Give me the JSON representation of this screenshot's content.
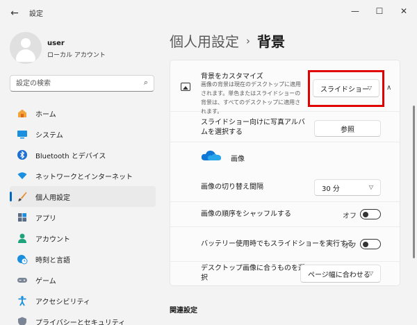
{
  "window": {
    "title": "設定",
    "back_icon": "←",
    "min_icon": "—",
    "max_icon": "☐",
    "close_icon": "✕"
  },
  "profile": {
    "name": "user",
    "account_type": "ローカル アカウント"
  },
  "search": {
    "placeholder": "設定の検索",
    "icon": "⌕"
  },
  "sidebar": {
    "items": [
      {
        "label": "ホーム",
        "icon": "home-icon"
      },
      {
        "label": "システム",
        "icon": "system-icon"
      },
      {
        "label": "Bluetooth とデバイス",
        "icon": "bluetooth-icon"
      },
      {
        "label": "ネットワークとインターネット",
        "icon": "wifi-icon"
      },
      {
        "label": "個人用設定",
        "icon": "brush-icon",
        "active": true
      },
      {
        "label": "アプリ",
        "icon": "apps-icon"
      },
      {
        "label": "アカウント",
        "icon": "account-icon"
      },
      {
        "label": "時刻と言語",
        "icon": "globe-clock-icon"
      },
      {
        "label": "ゲーム",
        "icon": "gamepad-icon"
      },
      {
        "label": "アクセシビリティ",
        "icon": "accessibility-icon"
      },
      {
        "label": "プライバシーとセキュリティ",
        "icon": "shield-icon"
      }
    ]
  },
  "breadcrumb": {
    "parent": "個人用設定",
    "separator": "›",
    "current": "背景"
  },
  "background": {
    "title": "背景をカスタマイズ",
    "description": "画像の背景は現在のデスクトップに適用されます。単色またはスライドショーの背景は、すべてのデスクトップに適用されます。",
    "mode_value": "スライドショー",
    "expand_icon": "∧"
  },
  "slideshow": {
    "album_label": "スライドショー向けに写真アルバムを選択する",
    "browse_label": "参照",
    "folder_name": "画像",
    "interval_label": "画像の切り替え間隔",
    "interval_value": "30 分",
    "shuffle_label": "画像の順序をシャッフルする",
    "shuffle_state": "オフ",
    "battery_label": "バッテリー使用時でもスライドショーを実行する",
    "battery_state": "オフ",
    "fit_label": "デスクトップ画像に合うものを選択",
    "fit_value": "ページ幅に合わせる"
  },
  "related": {
    "title": "関連設定"
  },
  "colors": {
    "accent": "#0067c0",
    "highlight": "#e00000",
    "onedrive": "#0f78d4"
  }
}
